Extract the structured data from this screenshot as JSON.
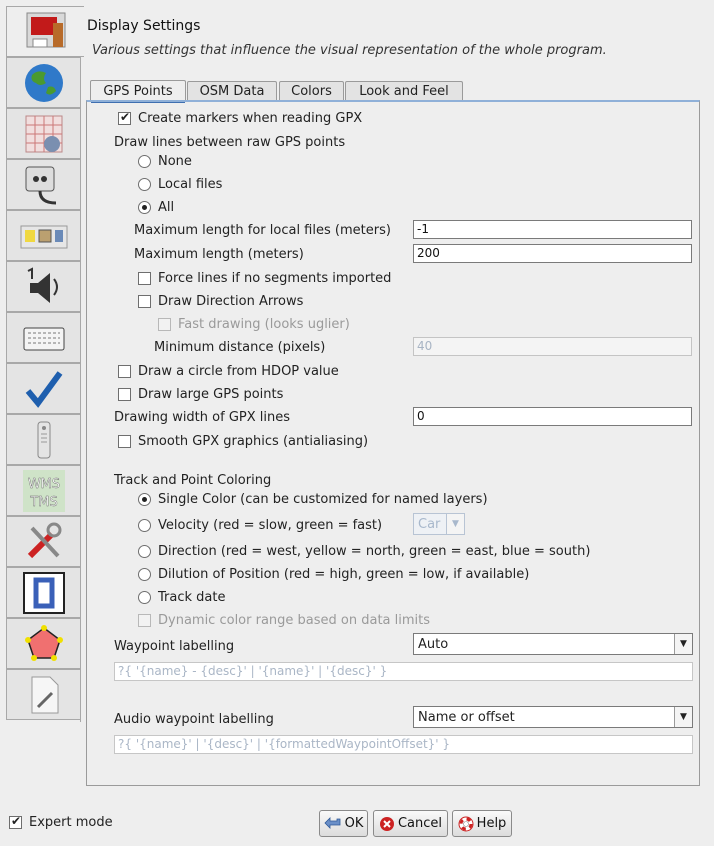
{
  "header": {
    "title": "Display Settings",
    "subtitle": "Various settings that influence the visual representation of the whole program."
  },
  "sidebar": {
    "items": [
      {
        "icon": "display-icon",
        "selected": true
      },
      {
        "icon": "globe-icon",
        "selected": false
      },
      {
        "icon": "projection-grid-icon",
        "selected": false
      },
      {
        "icon": "plugin-icon",
        "selected": false
      },
      {
        "icon": "toolbar-icon",
        "selected": false
      },
      {
        "icon": "audio-icon",
        "selected": false
      },
      {
        "icon": "keyboard-icon",
        "selected": false
      },
      {
        "icon": "validator-checkmark-icon",
        "selected": false
      },
      {
        "icon": "remote-control-icon",
        "selected": false
      },
      {
        "icon": "wms-tms-icon",
        "selected": false,
        "text_line1": "WMS",
        "text_line2": "TMS"
      },
      {
        "icon": "tools-icon",
        "selected": false
      },
      {
        "icon": "shortcut-icon",
        "selected": false
      },
      {
        "icon": "map-paint-icon",
        "selected": false
      },
      {
        "icon": "advanced-document-icon",
        "selected": false
      }
    ]
  },
  "tabs": [
    {
      "label": "GPS Points",
      "active": true
    },
    {
      "label": "OSM Data",
      "active": false
    },
    {
      "label": "Colors",
      "active": false
    },
    {
      "label": "Look and Feel",
      "active": false
    }
  ],
  "gps": {
    "create_markers": {
      "label": "Create markers when reading GPX",
      "checked": true
    },
    "draw_lines_heading": "Draw lines between raw GPS points",
    "draw_lines_options": [
      {
        "label": "None",
        "selected": false
      },
      {
        "label": "Local files",
        "selected": false
      },
      {
        "label": "All",
        "selected": true
      }
    ],
    "max_length_local": {
      "label": "Maximum length for local files (meters)",
      "value": "-1"
    },
    "max_length": {
      "label": "Maximum length (meters)",
      "value": "200"
    },
    "force_lines": {
      "label": "Force lines if no segments imported",
      "checked": false
    },
    "draw_arrows": {
      "label": "Draw Direction Arrows",
      "checked": false
    },
    "fast_drawing": {
      "label": "Fast drawing (looks uglier)",
      "checked": false,
      "enabled": false
    },
    "min_distance": {
      "label": "Minimum distance (pixels)",
      "value": "40",
      "enabled": false
    },
    "hdop_circle": {
      "label": "Draw a circle from HDOP value",
      "checked": false
    },
    "large_points": {
      "label": "Draw large GPS points",
      "checked": false
    },
    "drawing_width": {
      "label": "Drawing width of GPX lines",
      "value": "0"
    },
    "smooth_graphics": {
      "label": "Smooth GPX graphics (antialiasing)",
      "checked": false
    },
    "coloring_heading": "Track and Point Coloring",
    "coloring_options": [
      {
        "label": "Single Color (can be customized for named layers)",
        "selected": true
      },
      {
        "label": "Velocity (red = slow, green = fast)",
        "selected": false
      },
      {
        "label": "Direction (red = west, yellow = north, green = east, blue = south)",
        "selected": false
      },
      {
        "label": "Dilution of Position (red = high, green = low, if available)",
        "selected": false
      },
      {
        "label": "Track date",
        "selected": false
      }
    ],
    "velocity_combo": {
      "value": "Car",
      "enabled": false
    },
    "dynamic_range": {
      "label": "Dynamic color range based on data limits",
      "checked": false,
      "enabled": false
    },
    "waypoint_labelling": {
      "label": "Waypoint labelling",
      "selected": "Auto",
      "template": "?{ '{name} - {desc}' | '{name}' | '{desc}' }"
    },
    "audio_waypoint_labelling": {
      "label": "Audio waypoint labelling",
      "selected": "Name or offset",
      "template": "?{ '{name}' | '{desc}' | '{formattedWaypointOffset}' }"
    }
  },
  "footer": {
    "expert_mode": {
      "label": "Expert mode",
      "checked": true
    },
    "ok_label": "OK",
    "cancel_label": "Cancel",
    "help_label": "Help"
  },
  "colors": {
    "accent": "#3f6fb0",
    "checkmark_blue": "#1f5fae",
    "cancel_red": "#cc2222"
  }
}
